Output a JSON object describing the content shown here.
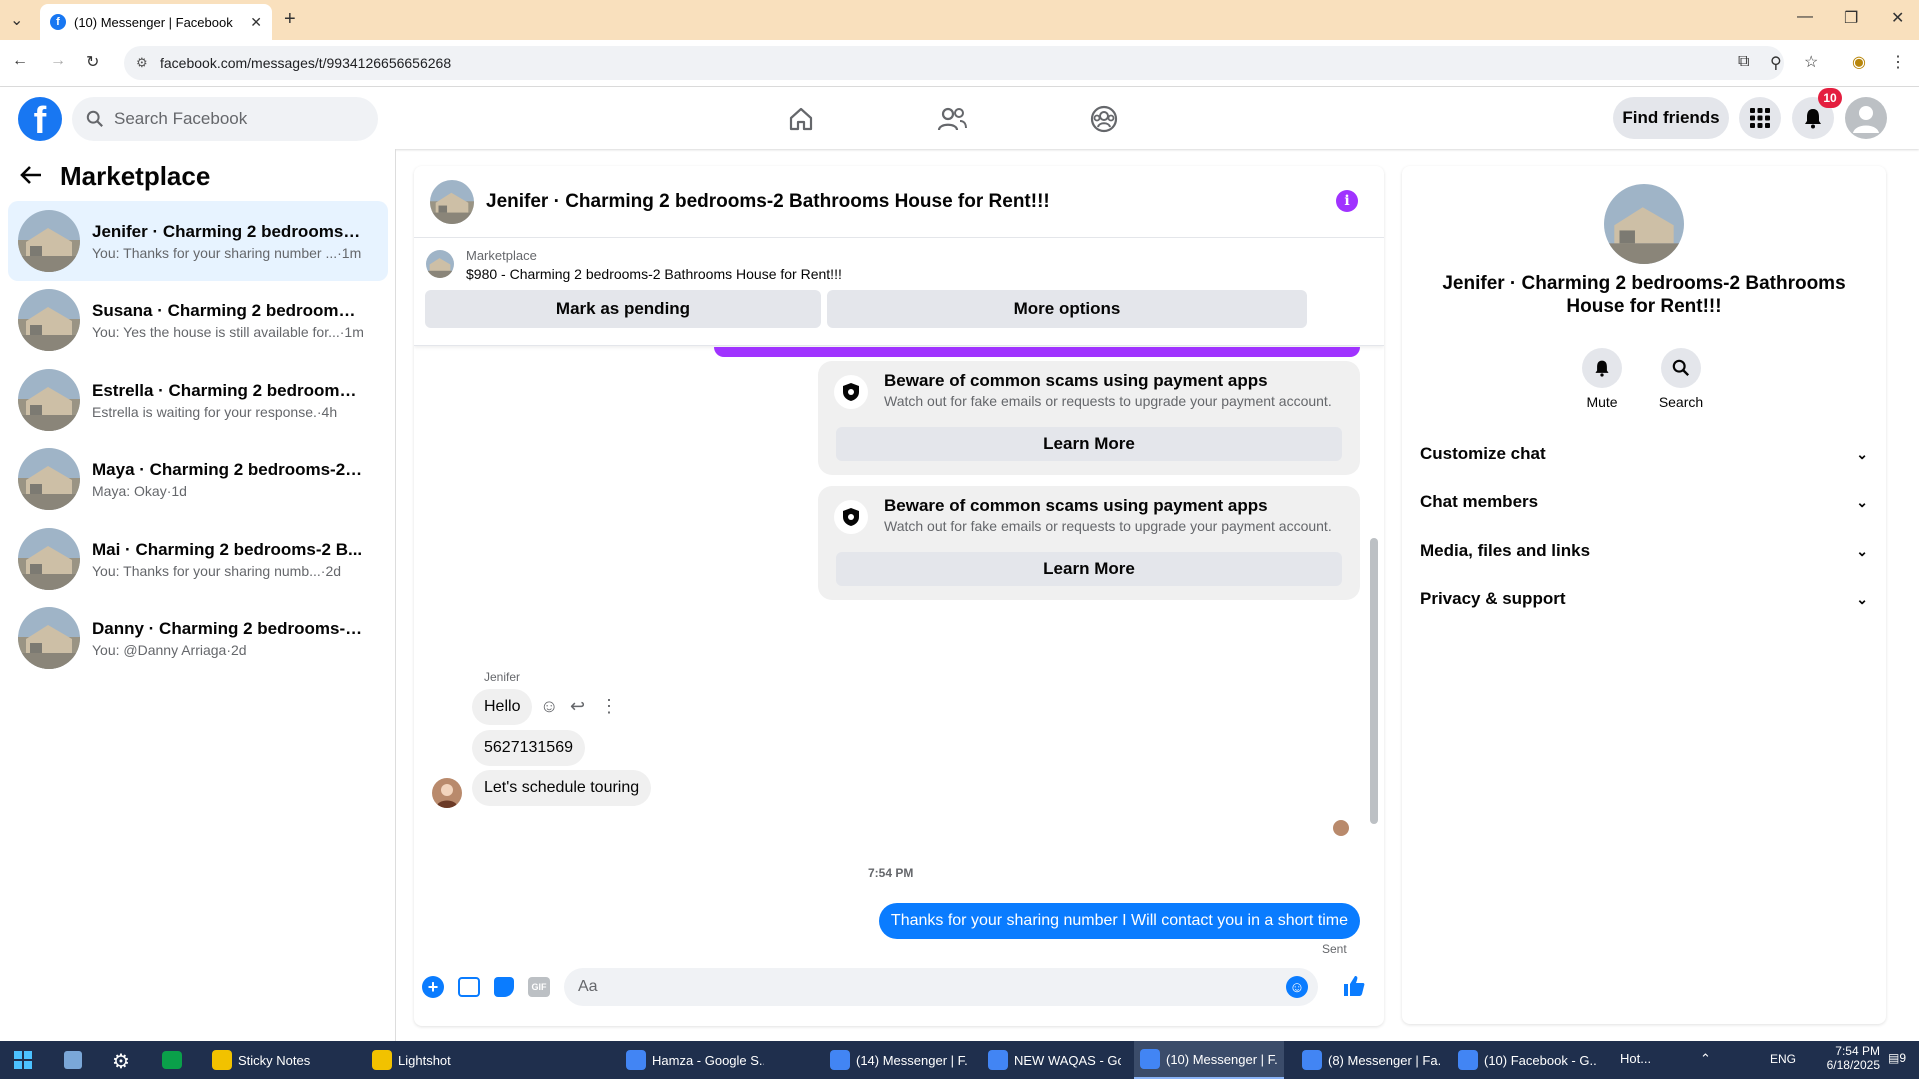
{
  "browser": {
    "tab_title": "(10) Messenger | Facebook",
    "url": "facebook.com/messages/t/9934126656656268"
  },
  "header": {
    "search_placeholder": "Search Facebook",
    "find_friends": "Find friends",
    "notif_count": "10"
  },
  "sidebar": {
    "title": "Marketplace",
    "conversations": [
      {
        "name": "Jenifer · Charming 2 bedrooms-2 ...",
        "preview": "You: Thanks for your sharing number ...·1m",
        "active": true
      },
      {
        "name": "Susana · Charming 2 bedrooms-2 ...",
        "preview": "You: Yes the house is still available for...·1m"
      },
      {
        "name": "Estrella · Charming 2 bedrooms-2 ...",
        "preview": "Estrella is waiting for your response.·4h"
      },
      {
        "name": "Maya · Charming 2 bedrooms-2 B...",
        "preview": "Maya: Okay·1d"
      },
      {
        "name": "Mai · Charming 2 bedrooms-2 B...",
        "preview": "You: Thanks for your sharing numb...·2d"
      },
      {
        "name": "Danny · Charming 2 bedrooms-2 B...",
        "preview": "You: @Danny Arriaga·2d"
      }
    ]
  },
  "chat": {
    "title": "Jenifer · Charming 2 bedrooms-2 Bathrooms House for Rent!!!",
    "marketplace_label": "Marketplace",
    "listing": "$980 - Charming 2 bedrooms-2 Bathrooms House for Rent!!!",
    "mark_pending": "Mark as pending",
    "more_options": "More options",
    "warnings": [
      {
        "title": "Beware of common scams using payment apps",
        "text": "Watch out for fake emails or requests to upgrade your payment account.",
        "button": "Learn More"
      },
      {
        "title": "Beware of common scams using payment apps",
        "text": "Watch out for fake emails or requests to upgrade your payment account.",
        "button": "Learn More"
      }
    ],
    "sender_name": "Jenifer",
    "messages": [
      "Hello",
      "5627131569",
      "Let's schedule touring"
    ],
    "timestamp": "7:54 PM",
    "my_message": "Thanks for your sharing number I Will contact you in  a short time",
    "status": "Sent",
    "input_placeholder": "Aa"
  },
  "details": {
    "title": "Jenifer · Charming 2 bedrooms-2 Bathrooms House for Rent!!!",
    "actions": [
      "Mute",
      "Search"
    ],
    "sections": [
      "Customize chat",
      "Chat members",
      "Media, files and links",
      "Privacy & support"
    ]
  },
  "taskbar": {
    "items": [
      "Sticky Notes",
      "Lightshot",
      "Hamza - Google S...",
      "(14) Messenger | F...",
      "NEW WAQAS - Go...",
      "(10) Messenger | F...",
      "(8) Messenger | Fa...",
      "(10) Facebook - G..."
    ],
    "weather": "Hot...",
    "lang": "ENG",
    "time": "7:54 PM",
    "date": "6/18/2025",
    "notif": "9"
  },
  "colors": {
    "brand": "#1877f2",
    "accent_purple": "#a033ff",
    "my_bubble": "#0a7cff"
  }
}
